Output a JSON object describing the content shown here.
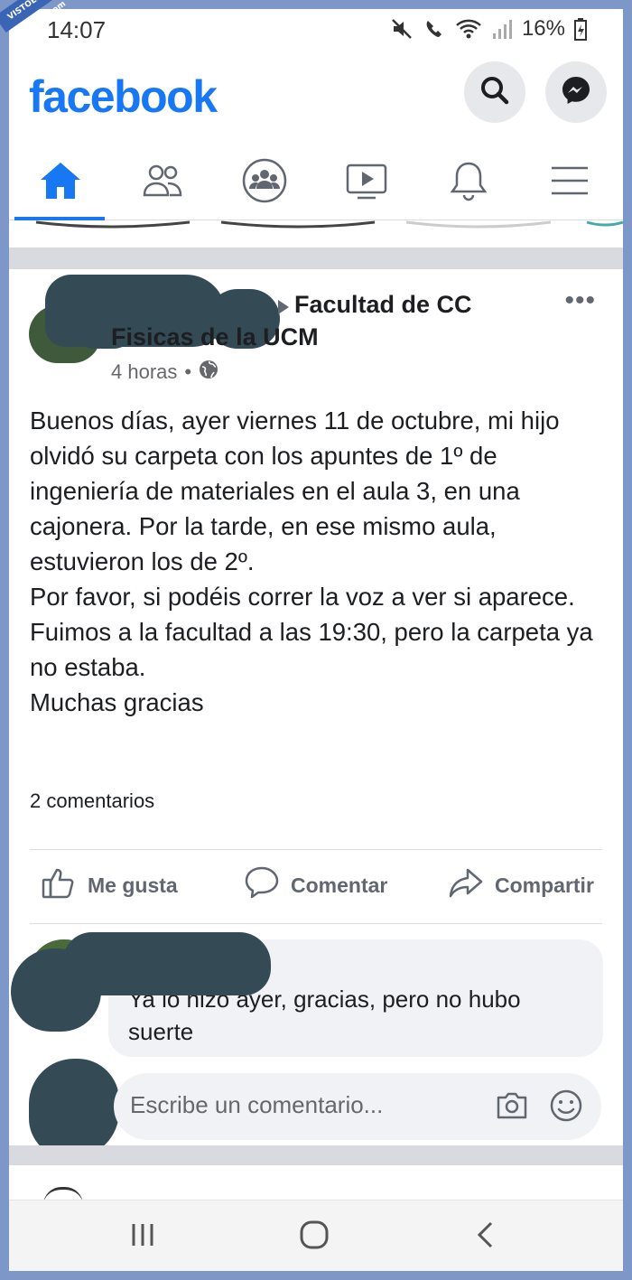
{
  "watermark": "VISTOENLASREDES .com",
  "status_bar": {
    "time": "14:07",
    "battery": "16%"
  },
  "header": {
    "logo": "facebook",
    "search_icon": "search-icon",
    "messenger_icon": "messenger-icon"
  },
  "nav": {
    "items": [
      {
        "icon": "home-icon",
        "active": true
      },
      {
        "icon": "friends-icon",
        "active": false
      },
      {
        "icon": "groups-icon",
        "active": false
      },
      {
        "icon": "watch-icon",
        "active": false
      },
      {
        "icon": "notifications-icon",
        "active": false
      },
      {
        "icon": "menu-icon",
        "active": false
      }
    ]
  },
  "post": {
    "group_line1": "Facultad de CC",
    "group_line2": "Fisicas de la UCM",
    "time": "4 horas",
    "dot": "•",
    "privacy_icon": "globe-icon",
    "more": "•••",
    "body": [
      "Buenos días, ayer viernes 11 de octubre, mi hijo olvidó su carpeta con los apuntes de 1º de ingeniería de materiales en el aula 3, en una cajonera. Por la tarde, en ese mismo aula, estuvieron los de 2º.",
      "Por favor, si podéis correr la voz a ver si aparece.",
      "Fuimos a la facultad a las 19:30, pero la carpeta ya no estaba.",
      "Muchas gracias"
    ],
    "comments_count": "2 comentarios",
    "actions": {
      "like": "Me gusta",
      "comment": "Comentar",
      "share": "Compartir"
    },
    "comment": {
      "text": "Ya lo hizo ayer, gracias, pero no hubo suerte"
    },
    "write_comment": {
      "placeholder": "Escribe un comentario..."
    }
  },
  "colors": {
    "brand": "#1877f2",
    "frame": "#7d97c9",
    "redaction": "#344b55"
  }
}
